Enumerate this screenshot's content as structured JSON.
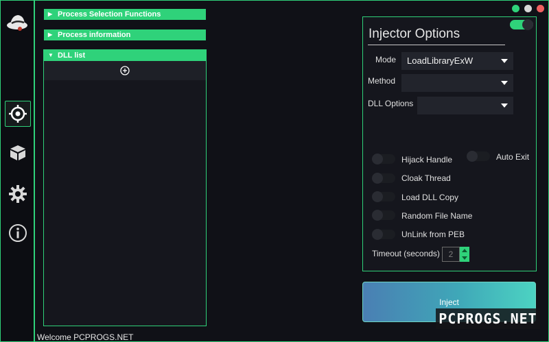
{
  "colors": {
    "accent": "#2fd27a",
    "background": "#101117",
    "panel": "#15161d",
    "close": "#f06060",
    "minimize": "#2fd27a",
    "maximize": "#d8d8d8"
  },
  "sidebar": {
    "logo": "hat-logo-icon",
    "items": [
      {
        "name": "target",
        "icon": "crosshair-icon",
        "active": true
      },
      {
        "name": "packages",
        "icon": "package-icon",
        "active": false
      },
      {
        "name": "settings",
        "icon": "gear-icon",
        "active": false
      },
      {
        "name": "info",
        "icon": "info-icon",
        "active": false
      }
    ]
  },
  "sections": {
    "process_selection": "Process Selection Functions",
    "process_information": "Process information",
    "dll_list": "DLL list"
  },
  "options": {
    "title": "Injector Options",
    "enabled": true,
    "mode_label": "Mode",
    "mode_value": "LoadLibraryExW",
    "method_label": "Method",
    "method_value": "",
    "dll_options_label": "DLL Options",
    "dll_options_value": "",
    "toggles": {
      "hijack_handle": "Hijack Handle",
      "auto_exit": "Auto Exit",
      "cloak_thread": "Cloak Thread",
      "load_dll_copy": "Load DLL  Copy",
      "random_file_name": "Random File Name",
      "unlink_from_peb": "UnLink from PEB"
    },
    "timeout_label": "Timeout (seconds)",
    "timeout_value": "2"
  },
  "inject_label": "Inject",
  "status_text": "Welcome PCPROGS.NET",
  "watermark": "PCPROGS.NET"
}
